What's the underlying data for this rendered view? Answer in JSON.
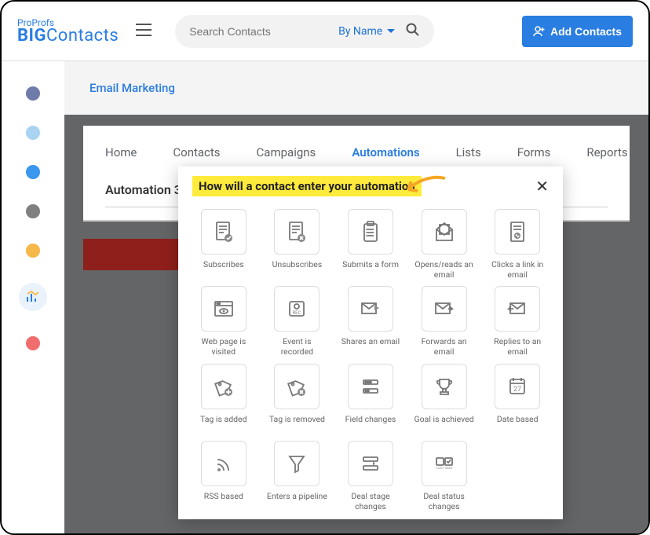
{
  "logo": {
    "small": "ProProfs",
    "big1": "BIG",
    "big2": "Contacts"
  },
  "search": {
    "placeholder": "Search Contacts",
    "byname": "By Name"
  },
  "addcontacts": "Add Contacts",
  "rail": {
    "colors": [
      "#6f7ba8",
      "#a8d4f1",
      "#3a97ef",
      "#7f7f7f",
      "#f5b84a",
      "#3a97ef",
      "#f16c6c"
    ]
  },
  "page": {
    "title": "Email Marketing"
  },
  "tabs": [
    "Home",
    "Contacts",
    "Campaigns",
    "Automations",
    "Lists",
    "Forms",
    "Reports"
  ],
  "active_tab": 3,
  "subtitle": "Automation 3",
  "modal": {
    "title": "How will a contact enter your automation",
    "triggers": [
      "Subscribes",
      "Unsubscribes",
      "Submits a form",
      "Opens/reads an email",
      "Clicks a link in email",
      "Web page is visited",
      "Event is recorded",
      "Shares an email",
      "Forwards an email",
      "Replies to an email",
      "Tag is added",
      "Tag is removed",
      "Field changes",
      "Goal is achieved",
      "Date based",
      "RSS based",
      "Enters a pipeline",
      "Deal stage changes",
      "Deal status changes"
    ],
    "calendar_day": "27"
  }
}
